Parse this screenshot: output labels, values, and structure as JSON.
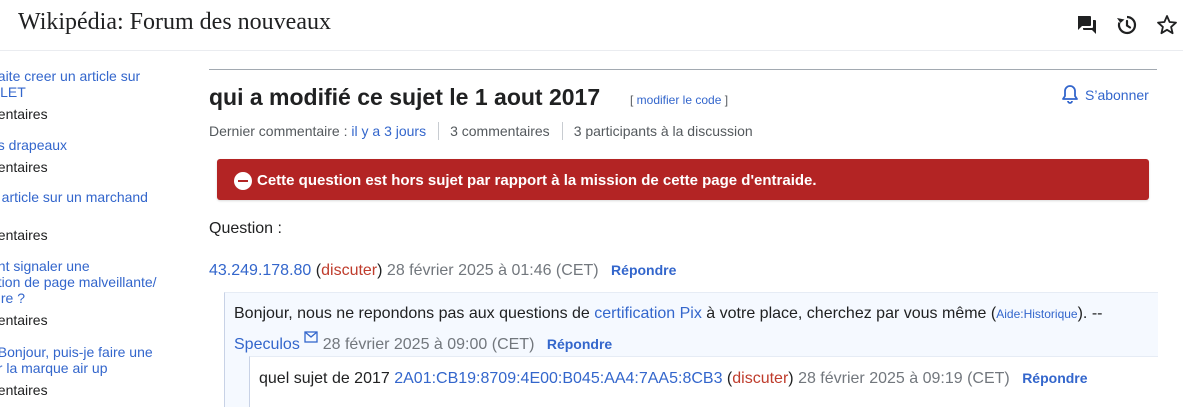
{
  "header": {
    "site_title": "Wikipédia: Forum des nouveaux",
    "icons": [
      "talk-icon",
      "history-icon",
      "watch-star-icon"
    ]
  },
  "sidebar": {
    "items": [
      {
        "title": "naite creer un article sur\nNLET",
        "meta": "nentaires"
      },
      {
        "title": "es drapeaux",
        "meta": "nentaires"
      },
      {
        "title": "n article sur un marchand\nn",
        "meta": "nentaires"
      },
      {
        "title": "ent signaler une\nation de page malveillante/\naire ?",
        "meta": "nentaires"
      },
      {
        "title": ", Bonjour, puis-je faire une\nur la marque air up",
        "meta": "nentaires"
      }
    ]
  },
  "topic": {
    "title": "qui a modifié ce sujet le 1 aout 2017",
    "edit_code": "modifier le code",
    "subscribe": "S’abonner",
    "last_comment_label": "Dernier commentaire :",
    "last_comment_time": "il y a 3 jours",
    "comments_count": "3 commentaires",
    "participants": "3 participants à la discussion"
  },
  "banner": {
    "prefix": "Cette question est ",
    "emphasis": "hors sujet",
    "suffix": " par rapport à la mission de cette page d'entraide.",
    "color": "#b32424"
  },
  "post0": {
    "text": "Question :",
    "user": "43.249.178.80",
    "talk": "discuter",
    "timestamp": "28 février 2025 à 01:46 (CET)",
    "reply": "Répondre"
  },
  "post1": {
    "text_a": "Bonjour, nous ne repondons pas aux questions de ",
    "link": "certification Pix",
    "text_b": " à votre place, cherchez par vous même (",
    "aide": "Aide:Historique",
    "text_c": "). --",
    "user": "Speculos",
    "timestamp": "28 février 2025 à 09:00 (CET)",
    "reply": "Répondre"
  },
  "post2": {
    "text": "quel sujet de 2017 ",
    "user": "2A01:CB19:8709:4E00:B045:AA4:7AA5:8CB3",
    "talk": "discuter",
    "timestamp": "28 février 2025 à 09:19 (CET)",
    "reply": "Répondre"
  }
}
